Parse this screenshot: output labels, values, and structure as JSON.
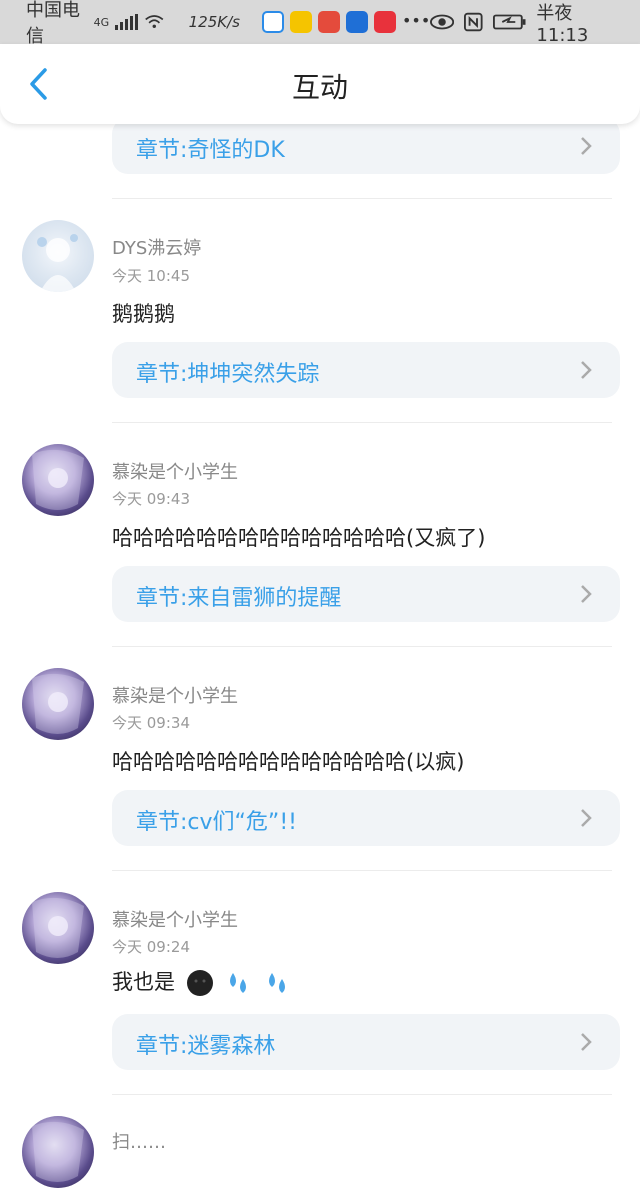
{
  "status_bar": {
    "carrier": "中国电信",
    "network": "4G",
    "speed": "125K/s",
    "time": "半夜11:13"
  },
  "header": {
    "title": "互动"
  },
  "top_chapter": {
    "label": "章节:奇怪的DK"
  },
  "comments": [
    {
      "username": "DYS沸云婷",
      "time": "今天 10:45",
      "text": "鹅鹅鹅",
      "chapter": "章节:坤坤突然失踪"
    },
    {
      "username": "慕染是个小学生",
      "time": "今天 09:43",
      "text": "哈哈哈哈哈哈哈哈哈哈哈哈哈哈(又疯了)",
      "chapter": "章节:来自雷狮的提醒"
    },
    {
      "username": "慕染是个小学生",
      "time": "今天 09:34",
      "text": "哈哈哈哈哈哈哈哈哈哈哈哈哈哈(以疯)",
      "chapter": "章节:cv们“危”!!"
    },
    {
      "username": "慕染是个小学生",
      "time": "今天 09:24",
      "text": "我也是",
      "chapter": "章节:迷雾森林"
    }
  ],
  "partial_username": "扫……"
}
